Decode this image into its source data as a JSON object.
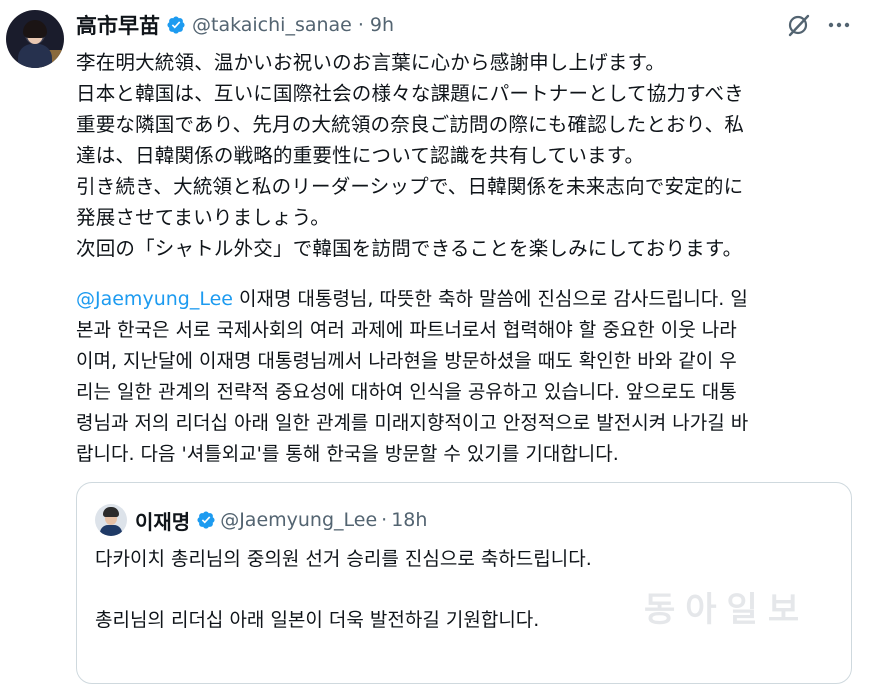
{
  "tweet": {
    "author_name": "高市早苗",
    "handle": "@takaichi_sanae",
    "separator": "·",
    "time": "9h",
    "text_jp": [
      "李在明大統領、温かいお祝いのお言葉に心から感謝申し上げます。",
      "日本と韓国は、互いに国際社会の様々な課題にパートナーとして協力すべき",
      "重要な隣国であり、先月の大統領の奈良ご訪問の際にも確認したとおり、私",
      "達は、日韓関係の戦略的重要性について認識を共有しています。",
      "引き続き、大統領と私のリーダーシップで、日韓関係を未来志向で安定的に",
      "発展させてまいりましょう。",
      "次回の「シャトル外交」で韓国を訪問できることを楽しみにしております。"
    ],
    "mention": "@Jaemyung_Lee",
    "text_ko_first_line_rest": " 이재명 대통령님, 따뜻한 축하 말씀에 진심으로 감사드립니다. 일",
    "text_ko": [
      "본과 한국은 서로 국제사회의 여러 과제에 파트너로서 협력해야 할 중요한 이웃 나라",
      "이며, 지난달에 이재명 대통령님께서 나라현을 방문하셨을 때도 확인한 바와 같이 우",
      "리는 일한 관계의 전략적 중요성에 대하여 인식을 공유하고 있습니다. 앞으로도 대통",
      "령님과 저의 리더십 아래 일한 관계를 미래지향적이고 안정적으로 발전시켜 나가길 바",
      "랍니다. 다음 '셔틀외교'를 통해 한국을 방문할 수 있기를 기대합니다."
    ]
  },
  "quoted": {
    "author_name": "이재명",
    "handle": "@Jaemyung_Lee",
    "separator": "·",
    "time": "18h",
    "line1": "다카이치 총리님의 중의원 선거 승리를 진심으로 축하드립니다.",
    "line2": "총리님의 리더십 아래 일본이 더욱 발전하길 기원합니다."
  },
  "watermark": "동아일보",
  "icons": {
    "verified": "verified-badge-icon",
    "grok": "grok-icon",
    "more": "more-icon"
  },
  "colors": {
    "verified_blue": "#1d9bf0",
    "text": "#0f1419",
    "muted": "#536471",
    "border": "#cfd9de"
  }
}
